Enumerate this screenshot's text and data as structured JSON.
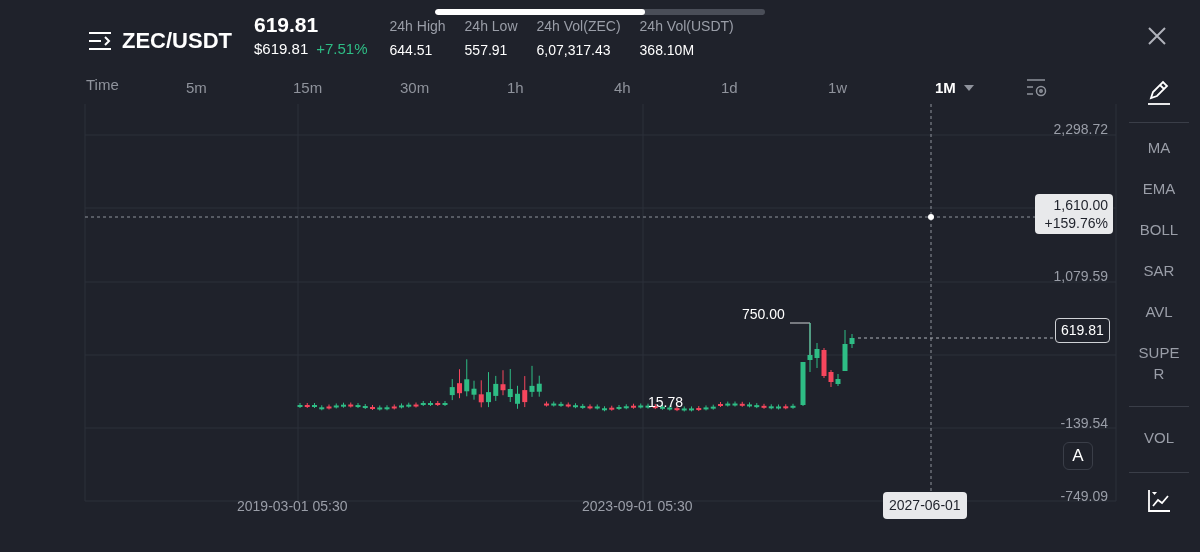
{
  "header": {
    "pair": "ZEC/USDT",
    "price": "619.81",
    "price_usd": "$619.81",
    "change": "+7.51%",
    "stats": [
      {
        "label": "24h High",
        "value": "644.51"
      },
      {
        "label": "24h Low",
        "value": "557.91"
      },
      {
        "label": "24h Vol(ZEC)",
        "value": "6,07,317.43"
      },
      {
        "label": "24h Vol(USDT)",
        "value": "368.10M"
      }
    ]
  },
  "time_label": "Time",
  "intervals": [
    {
      "label": "5m",
      "selected": false
    },
    {
      "label": "15m",
      "selected": false
    },
    {
      "label": "30m",
      "selected": false
    },
    {
      "label": "1h",
      "selected": false
    },
    {
      "label": "4h",
      "selected": false
    },
    {
      "label": "1d",
      "selected": false
    },
    {
      "label": "1w",
      "selected": false
    },
    {
      "label": "1M",
      "selected": true
    }
  ],
  "chart": {
    "y_labels": [
      "2,298.72",
      "1,079.59",
      "-139.54",
      "-749.09"
    ],
    "crosshair_price": "1,610.00",
    "crosshair_change": "+159.76%",
    "last_price": "619.81",
    "high_label": "750.00",
    "low_label": "15.78",
    "x_labels": [
      "2019-03-01 05:30",
      "2023-09-01 05:30"
    ],
    "crosshair_date": "2027-06-01",
    "auto_button": "A"
  },
  "indicators": [
    "MA",
    "EMA",
    "BOLL",
    "SAR",
    "AVL",
    "SUPER"
  ],
  "volume_indicator": "VOL"
}
